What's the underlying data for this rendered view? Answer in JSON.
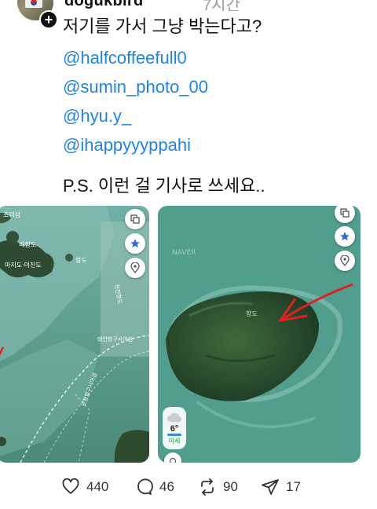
{
  "author": {
    "username": "dogukbird",
    "time_ago": "7시간"
  },
  "post": {
    "line1": "저기를 가서 그냥 박는다고?",
    "mentions": [
      "@halfcoffeefull0",
      "@sumin_photo_00",
      "@hyu.y_",
      "@ihappyyyppahi"
    ],
    "ps": "P.S. 이런 걸 기사로 쓰세요.."
  },
  "map_left": {
    "labels": [
      "초이섬",
      "비정도",
      "마지도·미진도",
      "항도",
      "전진항도",
      "태안항구사어섬",
      "모항항구사어섬"
    ]
  },
  "map_right": {
    "island_label": "항도",
    "watermark": "NAVER",
    "weather": {
      "temp": "6°",
      "dust": "미세"
    }
  },
  "actions": {
    "likes": "440",
    "replies": "46",
    "reposts": "90",
    "shares": "17"
  },
  "colors": {
    "mention": "#1d83f0",
    "sea": "#4e9a8b",
    "arrow": "#e0201e",
    "map_pin": "#2b6cd8"
  }
}
